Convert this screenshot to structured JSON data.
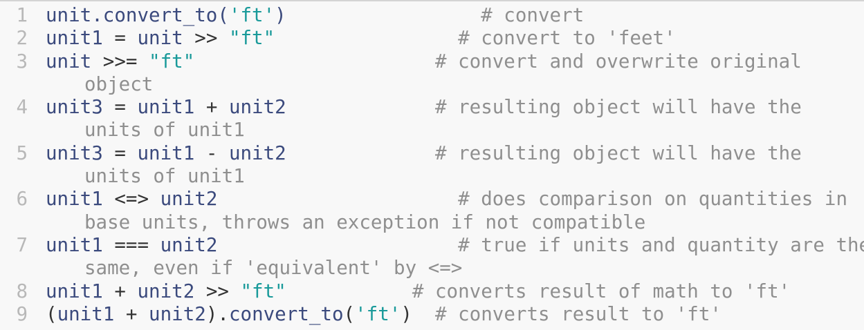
{
  "code": {
    "lines": [
      {
        "number": "1",
        "tokens": [
          "unit.convert_to(",
          "'ft'",
          ")",
          "                 ",
          "# convert"
        ],
        "wrap": ""
      },
      {
        "number": "2",
        "tokens": [
          "unit1",
          " = ",
          "unit",
          " >> ",
          "\"ft\"",
          "                ",
          "# convert to 'feet'"
        ],
        "wrap": ""
      },
      {
        "number": "3",
        "tokens": [
          "unit",
          " >>= ",
          "\"ft\"",
          "                     ",
          "# convert and overwrite original"
        ],
        "wrap": "object"
      },
      {
        "number": "4",
        "tokens": [
          "unit3",
          " = ",
          "unit1",
          " + ",
          "unit2",
          "             ",
          "# resulting object will have the"
        ],
        "wrap": "units of unit1"
      },
      {
        "number": "5",
        "tokens": [
          "unit3",
          " = ",
          "unit1",
          " - ",
          "unit2",
          "             ",
          "# resulting object will have the"
        ],
        "wrap": "units of unit1"
      },
      {
        "number": "6",
        "tokens": [
          "unit1",
          " <=> ",
          "unit2",
          "                     ",
          "# does comparison on quantities in"
        ],
        "wrap": "base units, throws an exception if not compatible"
      },
      {
        "number": "7",
        "tokens": [
          "unit1",
          " === ",
          "unit2",
          "                     ",
          "# true if units and quantity are the"
        ],
        "wrap": "same, even if 'equivalent' by <=>"
      },
      {
        "number": "8",
        "tokens": [
          "unit1",
          " + ",
          "unit2",
          " >> ",
          "\"ft\"",
          "           ",
          "# converts result of math to 'ft'"
        ],
        "wrap": ""
      },
      {
        "number": "9",
        "tokens": [
          "(",
          "unit1",
          " + ",
          "unit2",
          ").",
          "convert_to",
          "(",
          "'ft'",
          ")",
          "  ",
          "# converts result to 'ft'"
        ],
        "wrap": ""
      }
    ]
  },
  "colors": {
    "background": "#f8f8f8",
    "identifier": "#3b4a7d",
    "string": "#1a9a9a",
    "comment": "#8f8f8f",
    "line_number": "#b8b8b8"
  }
}
